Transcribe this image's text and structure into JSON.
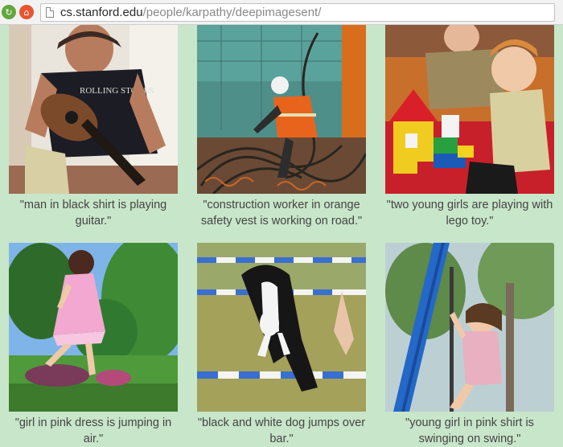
{
  "browser": {
    "url_host": "cs.stanford.edu",
    "url_path": "/people/karpathy/deepimagesent/"
  },
  "captions": [
    {
      "line1": "\"man in black shirt is playing",
      "line2": "guitar.\""
    },
    {
      "line1": "\"construction worker in orange",
      "line2": "safety vest is working on road.\""
    },
    {
      "line1": "\"two young girls are playing with",
      "line2": "lego toy.\""
    },
    {
      "line1": "\"girl in pink dress is jumping in",
      "line2": "air.\""
    },
    {
      "line1": "\"black and white dog jumps over",
      "line2": "bar.\""
    },
    {
      "line1": "\"young girl in pink shirt is",
      "line2": "swinging on swing.\""
    }
  ]
}
